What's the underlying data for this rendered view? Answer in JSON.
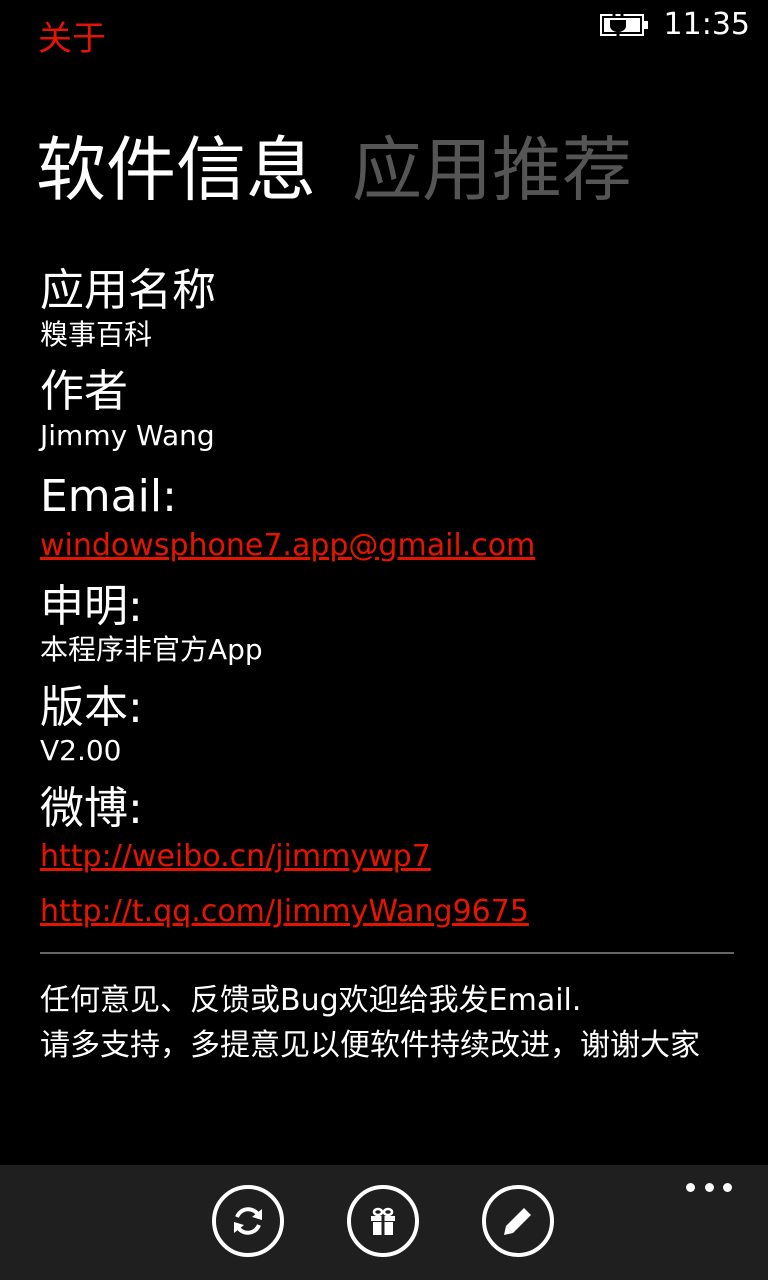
{
  "status": {
    "app_title": "关于",
    "time": "11:35"
  },
  "pivot": {
    "tabs": [
      {
        "label": "软件信息",
        "active": true
      },
      {
        "label": "应用推荐",
        "active": false
      }
    ]
  },
  "info": {
    "app_name_label": "应用名称",
    "app_name_value": "糗事百科",
    "author_label": "作者",
    "author_value": "Jimmy Wang",
    "email_label": "Email:",
    "email_value": "windowsphone7.app@gmail.com",
    "statement_label": "申明:",
    "statement_value": "本程序非官方App",
    "version_label": "版本:",
    "version_value": "V2.00",
    "weibo_label": "微博:",
    "weibo_links": [
      "http://weibo.cn/jimmywp7",
      "http://t.qq.com/JimmyWang9675"
    ],
    "feedback_text": "任何意见、反馈或Bug欢迎给我发Email.",
    "feedback_hint": "请多支持，多提意见以便软件持续改进，谢谢大家"
  },
  "app_bar": {
    "buttons": [
      {
        "icon": "refresh-icon"
      },
      {
        "icon": "gift-icon"
      },
      {
        "icon": "pencil-icon"
      }
    ],
    "more_icon": "ellipsis-icon"
  },
  "colors": {
    "accent": "#e51400",
    "background": "#000000",
    "app_bar": "#1f1f1f",
    "inactive_tab": "#555555"
  }
}
